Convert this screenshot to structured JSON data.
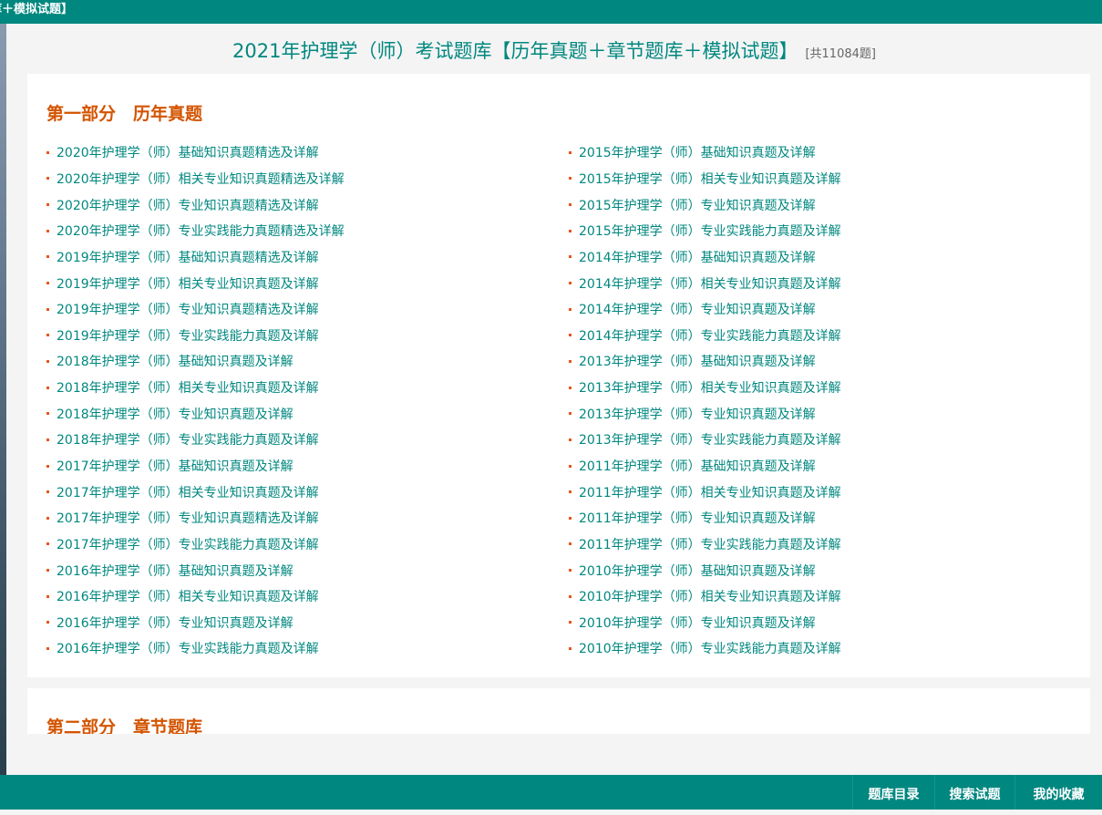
{
  "topbar": {
    "title": "库＋模拟试题】"
  },
  "header": {
    "title": "2021年护理学（师）考试题库【历年真题＋章节题库＋模拟试题】",
    "count": "[共11084题]"
  },
  "section1": {
    "heading": "第一部分　历年真题",
    "left": [
      "2020年护理学（师）基础知识真题精选及详解",
      "2020年护理学（师）相关专业知识真题精选及详解",
      "2020年护理学（师）专业知识真题精选及详解",
      "2020年护理学（师）专业实践能力真题精选及详解",
      "2019年护理学（师）基础知识真题精选及详解",
      "2019年护理学（师）相关专业知识真题及详解",
      "2019年护理学（师）专业知识真题精选及详解",
      "2019年护理学（师）专业实践能力真题及详解",
      "2018年护理学（师）基础知识真题及详解",
      "2018年护理学（师）相关专业知识真题及详解",
      "2018年护理学（师）专业知识真题及详解",
      "2018年护理学（师）专业实践能力真题及详解",
      "2017年护理学（师）基础知识真题及详解",
      "2017年护理学（师）相关专业知识真题及详解",
      "2017年护理学（师）专业知识真题精选及详解",
      "2017年护理学（师）专业实践能力真题及详解",
      "2016年护理学（师）基础知识真题及详解",
      "2016年护理学（师）相关专业知识真题及详解",
      "2016年护理学（师）专业知识真题及详解",
      "2016年护理学（师）专业实践能力真题及详解"
    ],
    "right": [
      "2015年护理学（师）基础知识真题及详解",
      "2015年护理学（师）相关专业知识真题及详解",
      "2015年护理学（师）专业知识真题及详解",
      "2015年护理学（师）专业实践能力真题及详解",
      "2014年护理学（师）基础知识真题及详解",
      "2014年护理学（师）相关专业知识真题及详解",
      "2014年护理学（师）专业知识真题及详解",
      "2014年护理学（师）专业实践能力真题及详解",
      "2013年护理学（师）基础知识真题及详解",
      "2013年护理学（师）相关专业知识真题及详解",
      "2013年护理学（师）专业知识真题及详解",
      "2013年护理学（师）专业实践能力真题及详解",
      "2011年护理学（师）基础知识真题及详解",
      "2011年护理学（师）相关专业知识真题及详解",
      "2011年护理学（师）专业知识真题及详解",
      "2011年护理学（师）专业实践能力真题及详解",
      "2010年护理学（师）基础知识真题及详解",
      "2010年护理学（师）相关专业知识真题及详解",
      "2010年护理学（师）专业知识真题及详解",
      "2010年护理学（师）专业实践能力真题及详解"
    ]
  },
  "section2": {
    "heading": "第二部分　章节题库"
  },
  "bottombar": {
    "catalog": "题库目录",
    "search": "搜索试题",
    "favorites": "我的收藏"
  }
}
